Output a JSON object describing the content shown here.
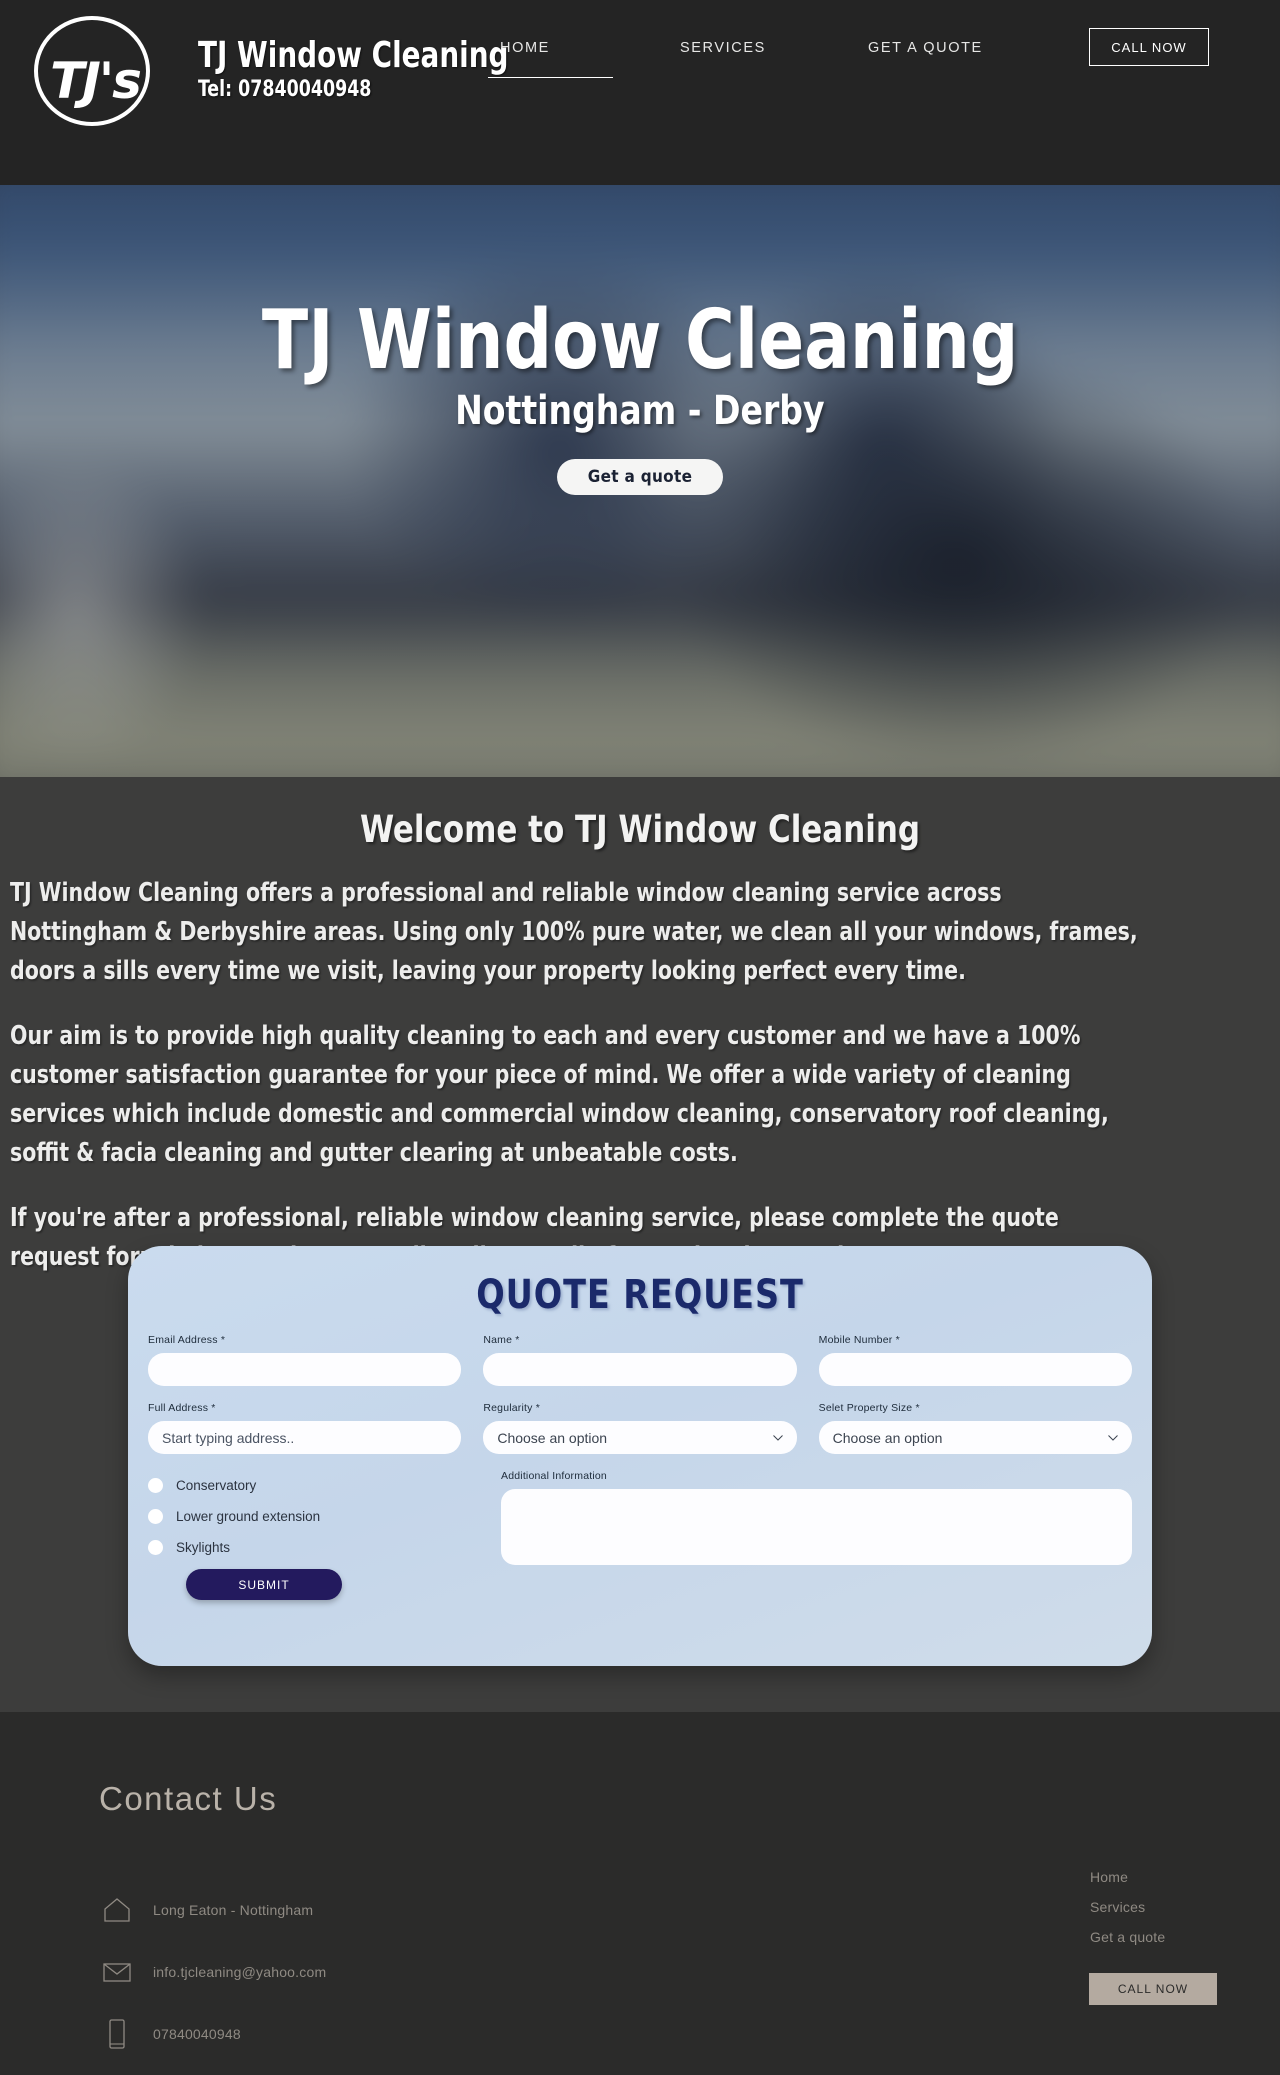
{
  "header": {
    "logo_text": "TJ's",
    "brand_name": "TJ Window Cleaning",
    "brand_tel": "Tel: 07840040948",
    "nav": [
      {
        "label": "HOME",
        "active": true
      },
      {
        "label": "SERVICES",
        "active": false
      },
      {
        "label": "GET A QUOTE",
        "active": false
      }
    ],
    "call_now_label": "CALL NOW"
  },
  "hero": {
    "title": "TJ Window Cleaning",
    "subtitle": "Nottingham - Derby",
    "cta_label": "Get a quote"
  },
  "main": {
    "welcome_title": "Welcome to TJ Window Cleaning",
    "paragraphs": [
      "TJ Window Cleaning offers a professional and reliable window cleaning service across Nottingham & Derbyshire areas.  Using only 100% pure water, we clean all your windows, frames, doors a sills every time we visit, leaving your property looking perfect every time.",
      "Our aim is to provide high quality cleaning to each and every customer and we have a 100% customer satisfaction guarantee for your piece of mind. We offer a wide variety of cleaning services which include domestic and commercial window cleaning, conservatory roof cleaning, soffit & facia cleaning and gutter clearing at unbeatable costs.",
      "If you're after a professional, reliable window cleaning service, please complete the quote request form below or give us a call to discuss all of your cleaning needs."
    ]
  },
  "quote_form": {
    "heading": "QUOTE REQUEST",
    "fields": {
      "email": {
        "label": "Email Address *",
        "value": "",
        "placeholder": ""
      },
      "name": {
        "label": "Name *",
        "value": "",
        "placeholder": ""
      },
      "mobile": {
        "label": "Mobile Number *",
        "value": "",
        "placeholder": ""
      },
      "address": {
        "label": "Full Address *",
        "value": "",
        "placeholder": "Start typing address.."
      },
      "regularity": {
        "label": "Regularity *",
        "selected": "Choose an option"
      },
      "property_size": {
        "label": "Selet Property Size *",
        "selected": "Choose an option"
      },
      "additional": {
        "label": "Additional Information",
        "value": "",
        "placeholder": ""
      }
    },
    "checkboxes": [
      {
        "label": "Conservatory",
        "checked": false
      },
      {
        "label": "Lower ground extension",
        "checked": false
      },
      {
        "label": "Skylights",
        "checked": false
      }
    ],
    "submit_label": "SUBMIT"
  },
  "footer": {
    "title": "Contact Us",
    "contacts": [
      {
        "icon": "home-icon",
        "text": "Long Eaton - Nottingham"
      },
      {
        "icon": "envelope-icon",
        "text": "info.tjcleaning@yahoo.com"
      },
      {
        "icon": "phone-icon",
        "text": "07840040948"
      }
    ],
    "links": [
      {
        "label": "Home"
      },
      {
        "label": "Services"
      },
      {
        "label": "Get a quote"
      }
    ],
    "call_now_label": "CALL NOW"
  },
  "colors": {
    "header_bg": "#242424",
    "body_bg": "#3d3d3c",
    "footer_bg": "#2b2b2a",
    "form_card_bg": "#c9daed",
    "form_heading": "#1b2a6b",
    "submit_bg": "#231a5e",
    "footer_accent": "#b4aaa0"
  }
}
